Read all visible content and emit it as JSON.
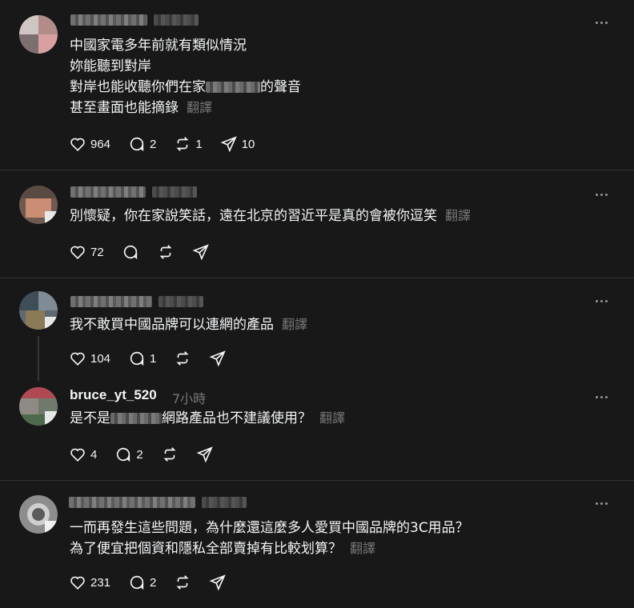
{
  "ui": {
    "translate": "翻譯"
  },
  "posts": [
    {
      "username": "",
      "time": "",
      "lines": [
        "中國家電多年前就有類似情況",
        "妳能聽到對岸",
        "對岸也能收聽你們在家",
        "的聲音",
        "甚至畫面也能摘錄"
      ],
      "likes": "964",
      "replies": "2",
      "reposts": "1",
      "shares": "10"
    },
    {
      "username": "",
      "time": "",
      "lines": [
        "別懷疑，你在家說笑話，遠在北京的習近平是真的會被你逗笑"
      ],
      "likes": "72",
      "replies": "",
      "reposts": "",
      "shares": ""
    },
    {
      "username": "",
      "time": "",
      "lines": [
        "我不敢買中國品牌可以連網的產品"
      ],
      "likes": "104",
      "replies": "1",
      "reposts": "",
      "shares": ""
    },
    {
      "username": "bruce_yt_520",
      "time": "7小時",
      "lines": [
        "是不是",
        "網路產品也不建議使用？"
      ],
      "likes": "4",
      "replies": "2",
      "reposts": "",
      "shares": ""
    },
    {
      "username": "",
      "time": "",
      "lines": [
        "一而再發生這些問題，為什麼還這麼多人愛買中國品牌的3C用品？",
        "為了便宜把個資和隱私全部賣掉有比較划算？"
      ],
      "likes": "231",
      "replies": "2",
      "reposts": "",
      "shares": ""
    }
  ],
  "icons": [
    "heart-icon",
    "comment-icon",
    "repost-icon",
    "share-icon",
    "more-icon"
  ],
  "colors": {
    "background": "#181818",
    "text": "#f3f5f7",
    "muted": "#777777",
    "divider": "#333638"
  }
}
